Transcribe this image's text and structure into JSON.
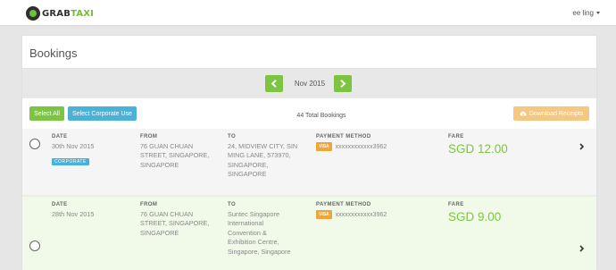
{
  "header": {
    "logo_part1": "GRAB",
    "logo_part2": "TAXI",
    "user_name": "ee ling"
  },
  "page": {
    "title": "Bookings",
    "month": "Nov 2015",
    "total_bookings": "44 Total Bookings"
  },
  "actions": {
    "select_all": "Select All",
    "select_corporate": "Select Corporate Use",
    "download_receipts": "Download Receipts"
  },
  "labels": {
    "date": "DATE",
    "from": "FROM",
    "to": "TO",
    "payment_method": "PAYMENT METHOD",
    "fare": "FARE"
  },
  "bookings": [
    {
      "date": "30th Nov 2015",
      "badge": "CORPORATE",
      "from": [
        "76 GUAN CHUAN",
        "STREET, SINGAPORE,",
        "SINGAPORE"
      ],
      "to": [
        "24, MIDVIEW CITY, SIN",
        "MING LANE, 573970,",
        "SINGAPORE,",
        "SINGAPORE"
      ],
      "card_type": "VISA",
      "card_number": "xxxxxxxxxxxx3962",
      "fare": "SGD 12.00"
    },
    {
      "date": "28th Nov 2015",
      "from": [
        "76 GUAN CHUAN",
        "STREET, SINGAPORE,",
        "SINGAPORE"
      ],
      "to": [
        "Suntec Singapore",
        "International",
        "Convention &",
        "Exhibition Centre,",
        "Singapore, Singapore"
      ],
      "card_type": "VISA",
      "card_number": "xxxxxxxxxxxx3962",
      "fare": "SGD 9.00"
    }
  ],
  "colors": {
    "accent_green": "#7dc442",
    "accent_blue": "#4ab2d8",
    "accent_orange": "#f5c77f",
    "visa_orange": "#f0a53a"
  },
  "icons": {
    "logo": "grab-logo-icon",
    "user_caret": "caret-down-icon",
    "prev": "chevron-left-icon",
    "next": "chevron-right-icon",
    "download": "cloud-download-icon",
    "row_detail": "chevron-right-icon"
  }
}
